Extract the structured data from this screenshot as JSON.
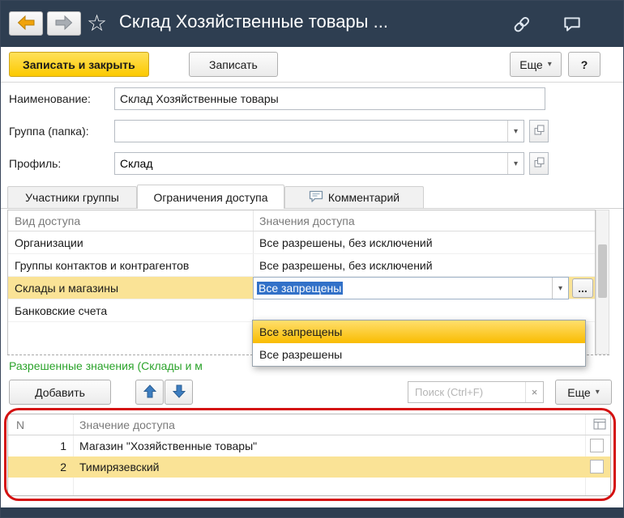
{
  "header": {
    "title": "Склад Хозяйственные товары ..."
  },
  "toolbar": {
    "save_close": "Записать и закрыть",
    "save": "Записать",
    "more": "Еще",
    "help": "?"
  },
  "icons": {
    "chevron_down": "▾",
    "star": "☆",
    "clear": "×",
    "ellipsis": "..."
  },
  "form": {
    "name": {
      "label": "Наименование:",
      "value": "Склад Хозяйственные товары"
    },
    "group": {
      "label": "Группа (папка):",
      "value": ""
    },
    "profile": {
      "label": "Профиль:",
      "value": "Склад"
    }
  },
  "tabs": {
    "members": "Участники группы",
    "restrictions": "Ограничения доступа",
    "comment": "Комментарий"
  },
  "access_table": {
    "col_kind": "Вид доступа",
    "col_values": "Значения доступа",
    "rows": [
      {
        "kind": "Организации",
        "value": "Все разрешены, без исключений"
      },
      {
        "kind": "Группы контактов и контрагентов",
        "value": "Все разрешены, без исключений"
      },
      {
        "kind": "Склады и магазины",
        "value": "Все запрещены"
      },
      {
        "kind": "Банковские счета",
        "value": ""
      }
    ]
  },
  "dropdown": {
    "options": [
      "Все запрещены",
      "Все разрешены"
    ],
    "selected": "Все запрещены"
  },
  "allowed_values": {
    "title": "Разрешенные значения (Склады и м",
    "add": "Добавить",
    "search_placeholder": "Поиск (Ctrl+F)",
    "more": "Еще"
  },
  "values_table": {
    "col_n": "N",
    "col_value": "Значение доступа",
    "rows": [
      {
        "n": "1",
        "value": "Магазин \"Хозяйственные товары\""
      },
      {
        "n": "2",
        "value": "Тимирязевский"
      }
    ]
  },
  "colors": {
    "titlebar_bg": "#2e3e51",
    "primary_btn_top": "#ffe15a",
    "primary_btn_bottom": "#fcc900",
    "row_selected": "#fae396",
    "dropdown_hl_top": "#ffdf6e",
    "dropdown_hl_bottom": "#f9bc00",
    "annotation": "#d41111",
    "green_text": "#2ba32b",
    "selection_bg": "#3271c8"
  }
}
